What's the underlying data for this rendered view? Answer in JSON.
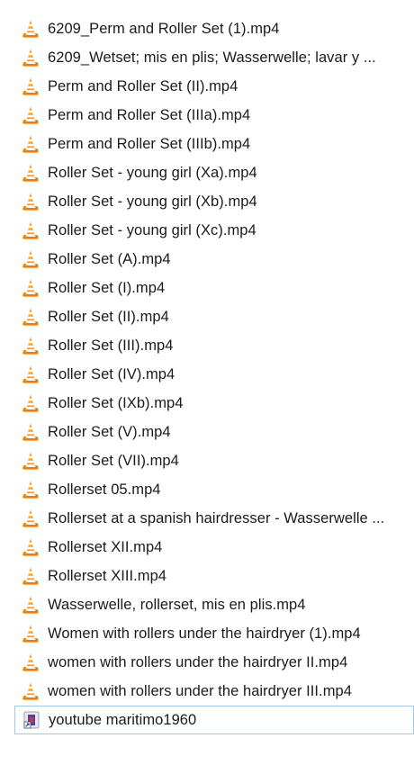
{
  "files": [
    {
      "name": "6209_Perm and Roller Set (1).mp4",
      "icon": "vlc-cone-icon"
    },
    {
      "name": "6209_Wetset; mis en plis; Wasserwelle; lavar y ...",
      "icon": "vlc-cone-icon"
    },
    {
      "name": "Perm and Roller Set (II).mp4",
      "icon": "vlc-cone-icon"
    },
    {
      "name": "Perm and Roller Set (IIIa).mp4",
      "icon": "vlc-cone-icon"
    },
    {
      "name": "Perm and Roller Set (IIIb).mp4",
      "icon": "vlc-cone-icon"
    },
    {
      "name": "Roller Set - young girl (Xa).mp4",
      "icon": "vlc-cone-icon"
    },
    {
      "name": "Roller Set - young girl (Xb).mp4",
      "icon": "vlc-cone-icon"
    },
    {
      "name": "Roller Set - young girl (Xc).mp4",
      "icon": "vlc-cone-icon"
    },
    {
      "name": "Roller Set (A).mp4",
      "icon": "vlc-cone-icon"
    },
    {
      "name": "Roller Set (I).mp4",
      "icon": "vlc-cone-icon"
    },
    {
      "name": "Roller Set (II).mp4",
      "icon": "vlc-cone-icon"
    },
    {
      "name": "Roller Set (III).mp4",
      "icon": "vlc-cone-icon"
    },
    {
      "name": "Roller Set (IV).mp4",
      "icon": "vlc-cone-icon"
    },
    {
      "name": "Roller Set (IXb).mp4",
      "icon": "vlc-cone-icon"
    },
    {
      "name": "Roller Set (V).mp4",
      "icon": "vlc-cone-icon"
    },
    {
      "name": "Roller Set (VII).mp4",
      "icon": "vlc-cone-icon"
    },
    {
      "name": "Rollerset 05.mp4",
      "icon": "vlc-cone-icon"
    },
    {
      "name": "Rollerset at a spanish hairdresser - Wasserwelle ...",
      "icon": "vlc-cone-icon"
    },
    {
      "name": "Rollerset XII.mp4",
      "icon": "vlc-cone-icon"
    },
    {
      "name": "Rollerset XIII.mp4",
      "icon": "vlc-cone-icon"
    },
    {
      "name": "Wasserwelle, rollerset, mis en plis.mp4",
      "icon": "vlc-cone-icon"
    },
    {
      "name": "Women with rollers under the hairdryer (1).mp4",
      "icon": "vlc-cone-icon"
    },
    {
      "name": "women with rollers under the hairdryer II.mp4",
      "icon": "vlc-cone-icon"
    },
    {
      "name": "women with rollers under the hairdryer III.mp4",
      "icon": "vlc-cone-icon"
    },
    {
      "name": "youtube maritimo1960",
      "icon": "shortcut-icon",
      "selected": true
    }
  ],
  "colors": {
    "vlc_orange": "#f57c00",
    "vlc_orange_light": "#ff9b1a",
    "vlc_stripe": "#ffffff",
    "selection_border": "#99c9ef",
    "text": "#1b1b1b"
  }
}
